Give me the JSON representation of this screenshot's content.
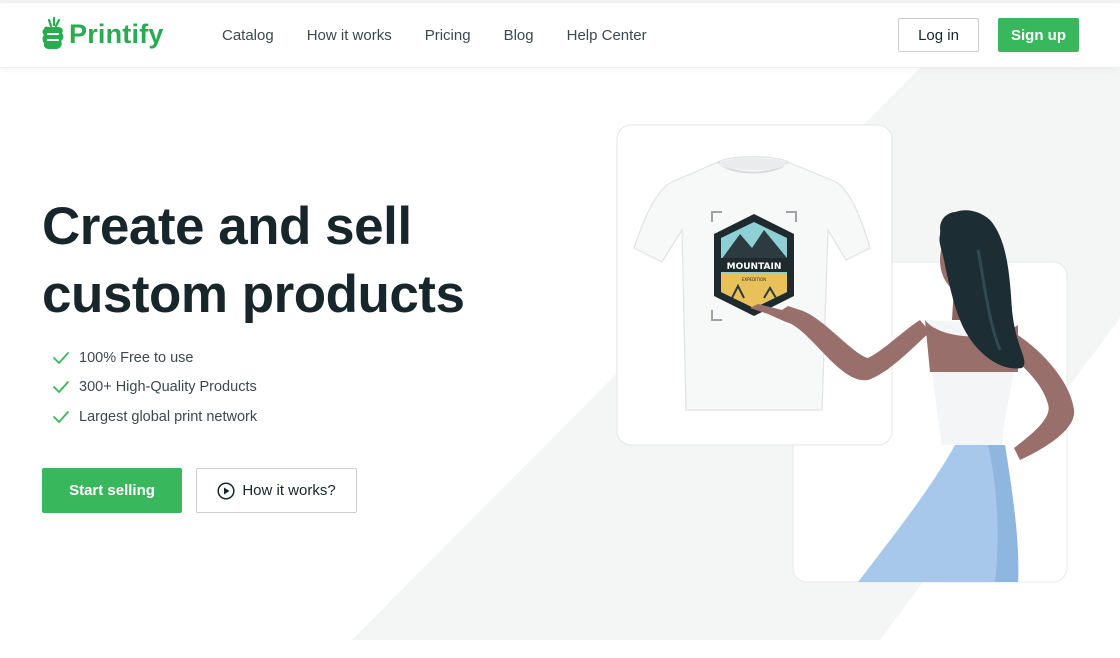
{
  "brand": {
    "name": "Printify",
    "accent": "#39b75d",
    "logo_color": "#29ab51"
  },
  "nav": {
    "items": [
      {
        "label": "Catalog"
      },
      {
        "label": "How it works"
      },
      {
        "label": "Pricing"
      },
      {
        "label": "Blog"
      },
      {
        "label": "Help Center"
      }
    ]
  },
  "auth": {
    "login_label": "Log in",
    "signup_label": "Sign up"
  },
  "hero": {
    "title_line1": "Create and sell",
    "title_line2": "custom products",
    "features": [
      {
        "label": "100% Free to use",
        "icon": "check-icon"
      },
      {
        "label": "300+ High-Quality Products",
        "icon": "check-icon"
      },
      {
        "label": "Largest global print network",
        "icon": "check-icon"
      }
    ],
    "cta_primary": "Start selling",
    "cta_secondary": "How it works?",
    "cta_secondary_icon": "play-circle-icon"
  },
  "illustration": {
    "design_text": "MOUNTAIN",
    "design_subtext": "EXPEDITION"
  }
}
